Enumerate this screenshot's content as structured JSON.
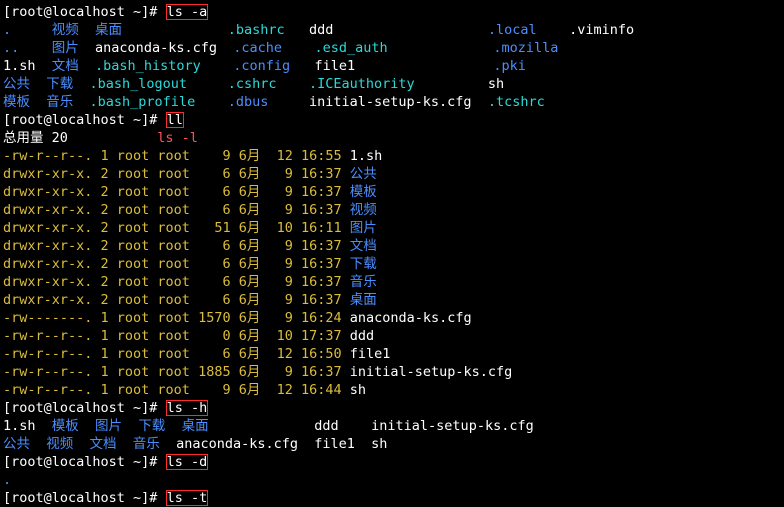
{
  "annot": "ls -l",
  "p1": "[root@localhost ~]# ",
  "c1": "ls -a",
  "p2": "[root@localhost ~]# ",
  "c2": "ll",
  "p3": "[root@localhost ~]# ",
  "c3": "ls -h",
  "p4": "[root@localhost ~]# ",
  "c4": "ls -d",
  "p5": "[root@localhost ~]# ",
  "c5": "ls -t",
  "la": {
    "r1c1": ".",
    "r1c2": "视频",
    "r1c3": "桌面",
    "r1c4": ".bashrc",
    "r1c5": "ddd",
    "r1c6": ".local",
    "r1c7": ".viminfo",
    "r2c1": "..",
    "r2c2": "图片",
    "r2c3": "anaconda-ks.cfg",
    "r2c4": ".cache",
    "r2c5": ".esd_auth",
    "r2c6": ".mozilla",
    "r3c1": "1.sh",
    "r3c2": "文档",
    "r3c3": ".bash_history",
    "r3c4": ".config",
    "r3c5": "file1",
    "r3c6": ".pki",
    "r4c1": "公共",
    "r4c2": "下载",
    "r4c3": ".bash_logout",
    "r4c4": ".cshrc",
    "r4c5": ".ICEauthority",
    "r4c6": "sh",
    "r5c1": "模板",
    "r5c2": "音乐",
    "r5c3": ".bash_profile",
    "r5c4": ".dbus",
    "r5c5": "initial-setup-ks.cfg",
    "r5c6": ".tcshrc"
  },
  "total": "总用量 20",
  "ll": [
    {
      "perm": "-rw-r--r--.",
      "n": "1",
      "u": "root",
      "g": "root",
      "s": "9",
      "m": "6月",
      "d": "12",
      "t": "16:55",
      "name": "1.sh",
      "dir": false
    },
    {
      "perm": "drwxr-xr-x.",
      "n": "2",
      "u": "root",
      "g": "root",
      "s": "6",
      "m": "6月",
      "d": "9",
      "t": "16:37",
      "name": "公共",
      "dir": true
    },
    {
      "perm": "drwxr-xr-x.",
      "n": "2",
      "u": "root",
      "g": "root",
      "s": "6",
      "m": "6月",
      "d": "9",
      "t": "16:37",
      "name": "模板",
      "dir": true
    },
    {
      "perm": "drwxr-xr-x.",
      "n": "2",
      "u": "root",
      "g": "root",
      "s": "6",
      "m": "6月",
      "d": "9",
      "t": "16:37",
      "name": "视频",
      "dir": true
    },
    {
      "perm": "drwxr-xr-x.",
      "n": "2",
      "u": "root",
      "g": "root",
      "s": "51",
      "m": "6月",
      "d": "10",
      "t": "16:11",
      "name": "图片",
      "dir": true
    },
    {
      "perm": "drwxr-xr-x.",
      "n": "2",
      "u": "root",
      "g": "root",
      "s": "6",
      "m": "6月",
      "d": "9",
      "t": "16:37",
      "name": "文档",
      "dir": true
    },
    {
      "perm": "drwxr-xr-x.",
      "n": "2",
      "u": "root",
      "g": "root",
      "s": "6",
      "m": "6月",
      "d": "9",
      "t": "16:37",
      "name": "下载",
      "dir": true
    },
    {
      "perm": "drwxr-xr-x.",
      "n": "2",
      "u": "root",
      "g": "root",
      "s": "6",
      "m": "6月",
      "d": "9",
      "t": "16:37",
      "name": "音乐",
      "dir": true
    },
    {
      "perm": "drwxr-xr-x.",
      "n": "2",
      "u": "root",
      "g": "root",
      "s": "6",
      "m": "6月",
      "d": "9",
      "t": "16:37",
      "name": "桌面",
      "dir": true
    },
    {
      "perm": "-rw-------.",
      "n": "1",
      "u": "root",
      "g": "root",
      "s": "1570",
      "m": "6月",
      "d": "9",
      "t": "16:24",
      "name": "anaconda-ks.cfg",
      "dir": false
    },
    {
      "perm": "-rw-r--r--.",
      "n": "1",
      "u": "root",
      "g": "root",
      "s": "0",
      "m": "6月",
      "d": "10",
      "t": "17:37",
      "name": "ddd",
      "dir": false
    },
    {
      "perm": "-rw-r--r--.",
      "n": "1",
      "u": "root",
      "g": "root",
      "s": "6",
      "m": "6月",
      "d": "12",
      "t": "16:50",
      "name": "file1",
      "dir": false
    },
    {
      "perm": "-rw-r--r--.",
      "n": "1",
      "u": "root",
      "g": "root",
      "s": "1885",
      "m": "6月",
      "d": "9",
      "t": "16:37",
      "name": "initial-setup-ks.cfg",
      "dir": false
    },
    {
      "perm": "-rw-r--r--.",
      "n": "1",
      "u": "root",
      "g": "root",
      "s": "9",
      "m": "6月",
      "d": "12",
      "t": "16:44",
      "name": "sh",
      "dir": false
    }
  ],
  "lh": {
    "r1": [
      "1.sh",
      "模板",
      "图片",
      "下载",
      "桌面",
      "ddd",
      "initial-setup-ks.cfg"
    ],
    "r2": [
      "公共",
      "视频",
      "文档",
      "音乐",
      "anaconda-ks.cfg",
      "file1",
      "sh"
    ]
  },
  "ld": "."
}
